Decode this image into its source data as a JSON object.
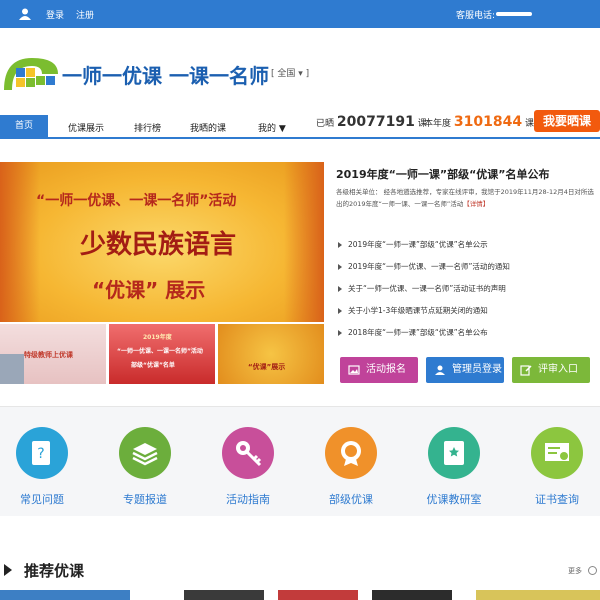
{
  "topbar": {
    "login": "登录",
    "register": "注册",
    "phone_label": "客服电话:"
  },
  "logo": {
    "text": "一师一优课 一课一名师",
    "region": "[ 全国 ▾ ]"
  },
  "nav": {
    "items": [
      "首页",
      "优课展示",
      "排行榜",
      "我晒的课",
      "我的 ▼"
    ]
  },
  "stats": {
    "prefix": "已晒",
    "count1": "20077191",
    "unit1": "课",
    "year_label": "本年度",
    "count2": "3101844",
    "unit2": "课"
  },
  "cta": "我要晒课",
  "banner": {
    "line1": "“一师一优课、一课一名师”活动",
    "line2": "少数民族语言",
    "line3": "“优课” 展示",
    "thumb1": "特级教师上优课",
    "thumb2a": "2019年度",
    "thumb2b": "“一师一优课、一课一名师”活动",
    "thumb2c": "部级“优课”名单",
    "thumb3": "“优课”展示"
  },
  "news": {
    "title": "2019年度“一师一课”部级“优课”名单公布",
    "desc": "各级相关单位： 经各地遴选推荐，专家在线评审，我馆于2019年11月28-12月4日对所选出的2019年度“一师一课、一课一名师”活动",
    "more": "【详情】",
    "items": [
      "2019年度“一师一课”部级“优课”名单公示",
      "2019年度“一师一优课、一课一名师”活动的通知",
      "关于“一师一优课、一课一名师”活动证书的声明",
      "关于小学1-3年级晒课节点延期关闭的通知",
      "2018年度“一师一课”部级“优课”名单公布"
    ]
  },
  "buttons": {
    "signup": "活动报名",
    "admin": "管理员登录",
    "review": "评审入口"
  },
  "features": [
    {
      "label": "常见问题",
      "color": "#2aa3d8"
    },
    {
      "label": "专题报道",
      "color": "#6cae3c"
    },
    {
      "label": "活动指南",
      "color": "#c84f9a"
    },
    {
      "label": "部级优课",
      "color": "#f0912a"
    },
    {
      "label": "优课教研室",
      "color": "#34b38f"
    },
    {
      "label": "证书查询",
      "color": "#8cc63f"
    }
  ],
  "recommend": {
    "title": "推荐优课",
    "more": "更多"
  },
  "colors": {
    "primary": "#2f7bd0",
    "accent": "#f25a0e",
    "signup": "#c0439a",
    "admin": "#2f7bd0",
    "review": "#7cb83a"
  }
}
